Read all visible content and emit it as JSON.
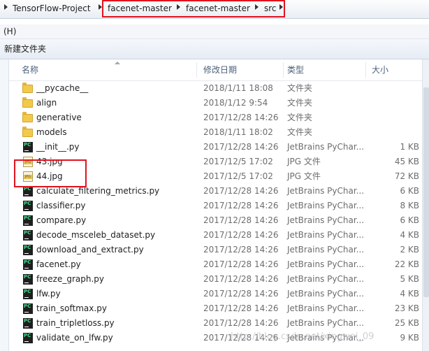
{
  "breadcrumb": {
    "items": [
      "TensorFlow-Project",
      "facenet-master",
      "facenet-master",
      "src"
    ]
  },
  "menubar": {
    "help_label": "(H)"
  },
  "toolbar": {
    "new_folder_label": "新建文件夹"
  },
  "columns": {
    "name": "名称",
    "date": "修改日期",
    "type": "类型",
    "size": "大小"
  },
  "files": [
    {
      "icon": "folder-icon",
      "name": "__pycache__",
      "date": "2018/1/11 18:08",
      "type": "文件夹",
      "size": ""
    },
    {
      "icon": "folder-icon",
      "name": "align",
      "date": "2018/1/12 9:54",
      "type": "文件夹",
      "size": ""
    },
    {
      "icon": "folder-icon",
      "name": "generative",
      "date": "2017/12/28 14:26",
      "type": "文件夹",
      "size": ""
    },
    {
      "icon": "folder-icon",
      "name": "models",
      "date": "2018/1/11 18:02",
      "type": "文件夹",
      "size": ""
    },
    {
      "icon": "pycharm-file-icon",
      "name": "__init__.py",
      "date": "2017/12/28 14:26",
      "type": "JetBrains PyChar...",
      "size": "1 KB"
    },
    {
      "icon": "jpg-file-icon",
      "name": "43.jpg",
      "date": "2017/12/5 17:02",
      "type": "JPG 文件",
      "size": "45 KB"
    },
    {
      "icon": "jpg-file-icon",
      "name": "44.jpg",
      "date": "2017/12/5 17:02",
      "type": "JPG 文件",
      "size": "72 KB"
    },
    {
      "icon": "pycharm-file-icon",
      "name": "calculate_filtering_metrics.py",
      "date": "2017/12/28 14:26",
      "type": "JetBrains PyChar...",
      "size": "6 KB"
    },
    {
      "icon": "pycharm-file-icon",
      "name": "classifier.py",
      "date": "2017/12/28 14:26",
      "type": "JetBrains PyChar...",
      "size": "8 KB"
    },
    {
      "icon": "pycharm-file-icon",
      "name": "compare.py",
      "date": "2017/12/28 14:26",
      "type": "JetBrains PyChar...",
      "size": "6 KB"
    },
    {
      "icon": "pycharm-file-icon",
      "name": "decode_msceleb_dataset.py",
      "date": "2017/12/28 14:26",
      "type": "JetBrains PyChar...",
      "size": "4 KB"
    },
    {
      "icon": "pycharm-file-icon",
      "name": "download_and_extract.py",
      "date": "2017/12/28 14:26",
      "type": "JetBrains PyChar...",
      "size": "2 KB"
    },
    {
      "icon": "pycharm-file-icon",
      "name": "facenet.py",
      "date": "2017/12/28 14:26",
      "type": "JetBrains PyChar...",
      "size": "22 KB"
    },
    {
      "icon": "pycharm-file-icon",
      "name": "freeze_graph.py",
      "date": "2017/12/28 14:26",
      "type": "JetBrains PyChar...",
      "size": "5 KB"
    },
    {
      "icon": "pycharm-file-icon",
      "name": "lfw.py",
      "date": "2017/12/28 14:26",
      "type": "JetBrains PyChar...",
      "size": "4 KB"
    },
    {
      "icon": "pycharm-file-icon",
      "name": "train_softmax.py",
      "date": "2017/12/28 14:26",
      "type": "JetBrains PyChar...",
      "size": "23 KB"
    },
    {
      "icon": "pycharm-file-icon",
      "name": "train_tripletloss.py",
      "date": "2017/12/28 14:26",
      "type": "JetBrains PyChar...",
      "size": "25 KB"
    },
    {
      "icon": "pycharm-file-icon",
      "name": "validate_on_lfw.py",
      "date": "2017/12/28 14:26",
      "type": "JetBrains PyChar...",
      "size": "9 KB"
    }
  ],
  "watermark": "http://blog.csdn.net/xingwei_09",
  "colors": {
    "highlight_box": "#e0141e",
    "header_text": "#4c607a",
    "folder": "#f3c94a"
  }
}
